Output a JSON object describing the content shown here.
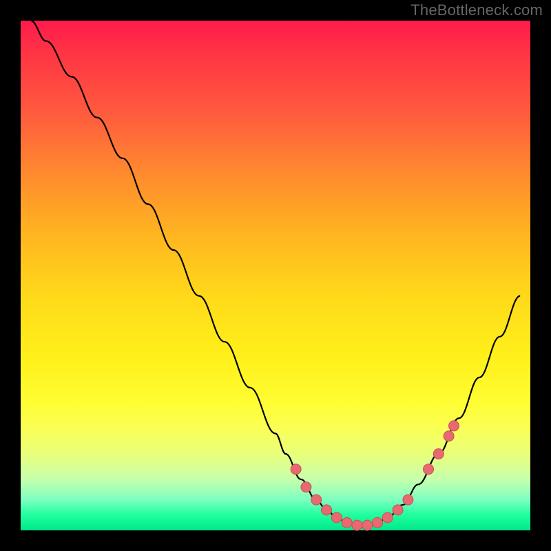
{
  "watermark": "TheBottleneck.com",
  "colors": {
    "background": "#000000",
    "gradient_top": "#ff1a4d",
    "gradient_bottom": "#00e88a",
    "curve": "#000000",
    "marker_fill": "#e66a6f",
    "marker_stroke": "#c94f57"
  },
  "chart_data": {
    "type": "line",
    "title": "",
    "xlabel": "",
    "ylabel": "",
    "xlim": [
      0,
      100
    ],
    "ylim": [
      0,
      100
    ],
    "series": [
      {
        "name": "bottleneck-curve",
        "x": [
          2,
          5,
          10,
          15,
          20,
          25,
          30,
          35,
          40,
          45,
          50,
          52,
          55,
          58,
          60,
          62,
          64,
          66,
          68,
          70,
          72,
          75,
          78,
          82,
          86,
          90,
          94,
          98
        ],
        "y": [
          100,
          96,
          89,
          81,
          73,
          64,
          55,
          46,
          37,
          28,
          19,
          15,
          10,
          6,
          4,
          2.5,
          1.5,
          1,
          1,
          1.5,
          2.5,
          5,
          9,
          15,
          22,
          30,
          38,
          46
        ]
      }
    ],
    "markers": {
      "name": "highlight-points",
      "x": [
        54,
        56,
        58,
        60,
        62,
        64,
        66,
        68,
        70,
        72,
        74,
        76,
        80,
        82,
        84,
        85
      ],
      "y": [
        12,
        8.5,
        6,
        4,
        2.5,
        1.5,
        1,
        1,
        1.5,
        2.5,
        4,
        6,
        12,
        15,
        18.5,
        20.5
      ]
    }
  }
}
